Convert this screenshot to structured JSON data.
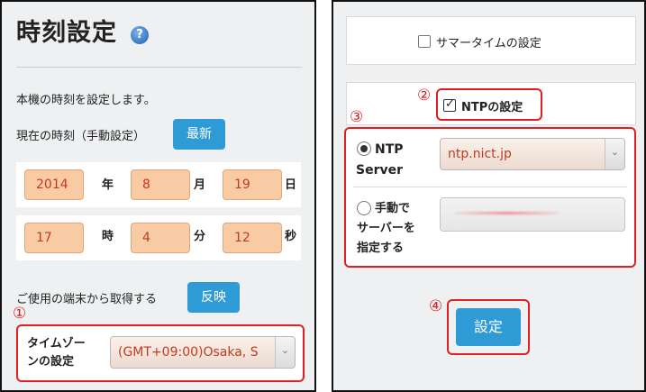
{
  "left": {
    "title": "時刻設定",
    "help_icon": "?",
    "description": "本機の時刻を設定します。",
    "current_time_label": "現在の時刻（手動設定）",
    "refresh_button": "最新",
    "date": {
      "year": "2014",
      "year_unit": "年",
      "month": "8",
      "month_unit": "月",
      "day": "19",
      "day_unit": "日"
    },
    "time": {
      "hour": "17",
      "hour_unit": "時",
      "minute": "4",
      "minute_unit": "分",
      "second": "12",
      "second_unit": "秒"
    },
    "device_sync_label": "ご使用の端末から取得する",
    "apply_button": "反映",
    "marker_1": "①",
    "timezone_label_line1": "タイムゾー",
    "timezone_label_line2": "ンの設定",
    "timezone_value": "(GMT+09:00)Osaka, S"
  },
  "right": {
    "summer_time_label": "サマータイムの設定",
    "marker_2": "②",
    "ntp_label": "NTPの設定",
    "marker_3": "③",
    "ntp_server_label_line1": "NTP",
    "ntp_server_label_line2": "Server",
    "ntp_server_value": "ntp.nict.jp",
    "manual_label_line1": "手動で",
    "manual_label_line2": "サーバーを",
    "manual_label_line3": "指定する",
    "marker_4": "④",
    "set_button": "設定"
  },
  "icons": {
    "dropdown_arrow": "⌄"
  },
  "colors": {
    "accent_blue": "#2f9bd6",
    "highlight_red": "#e02020",
    "field_orange": "#f8cba5",
    "value_red": "#c33a1f"
  }
}
